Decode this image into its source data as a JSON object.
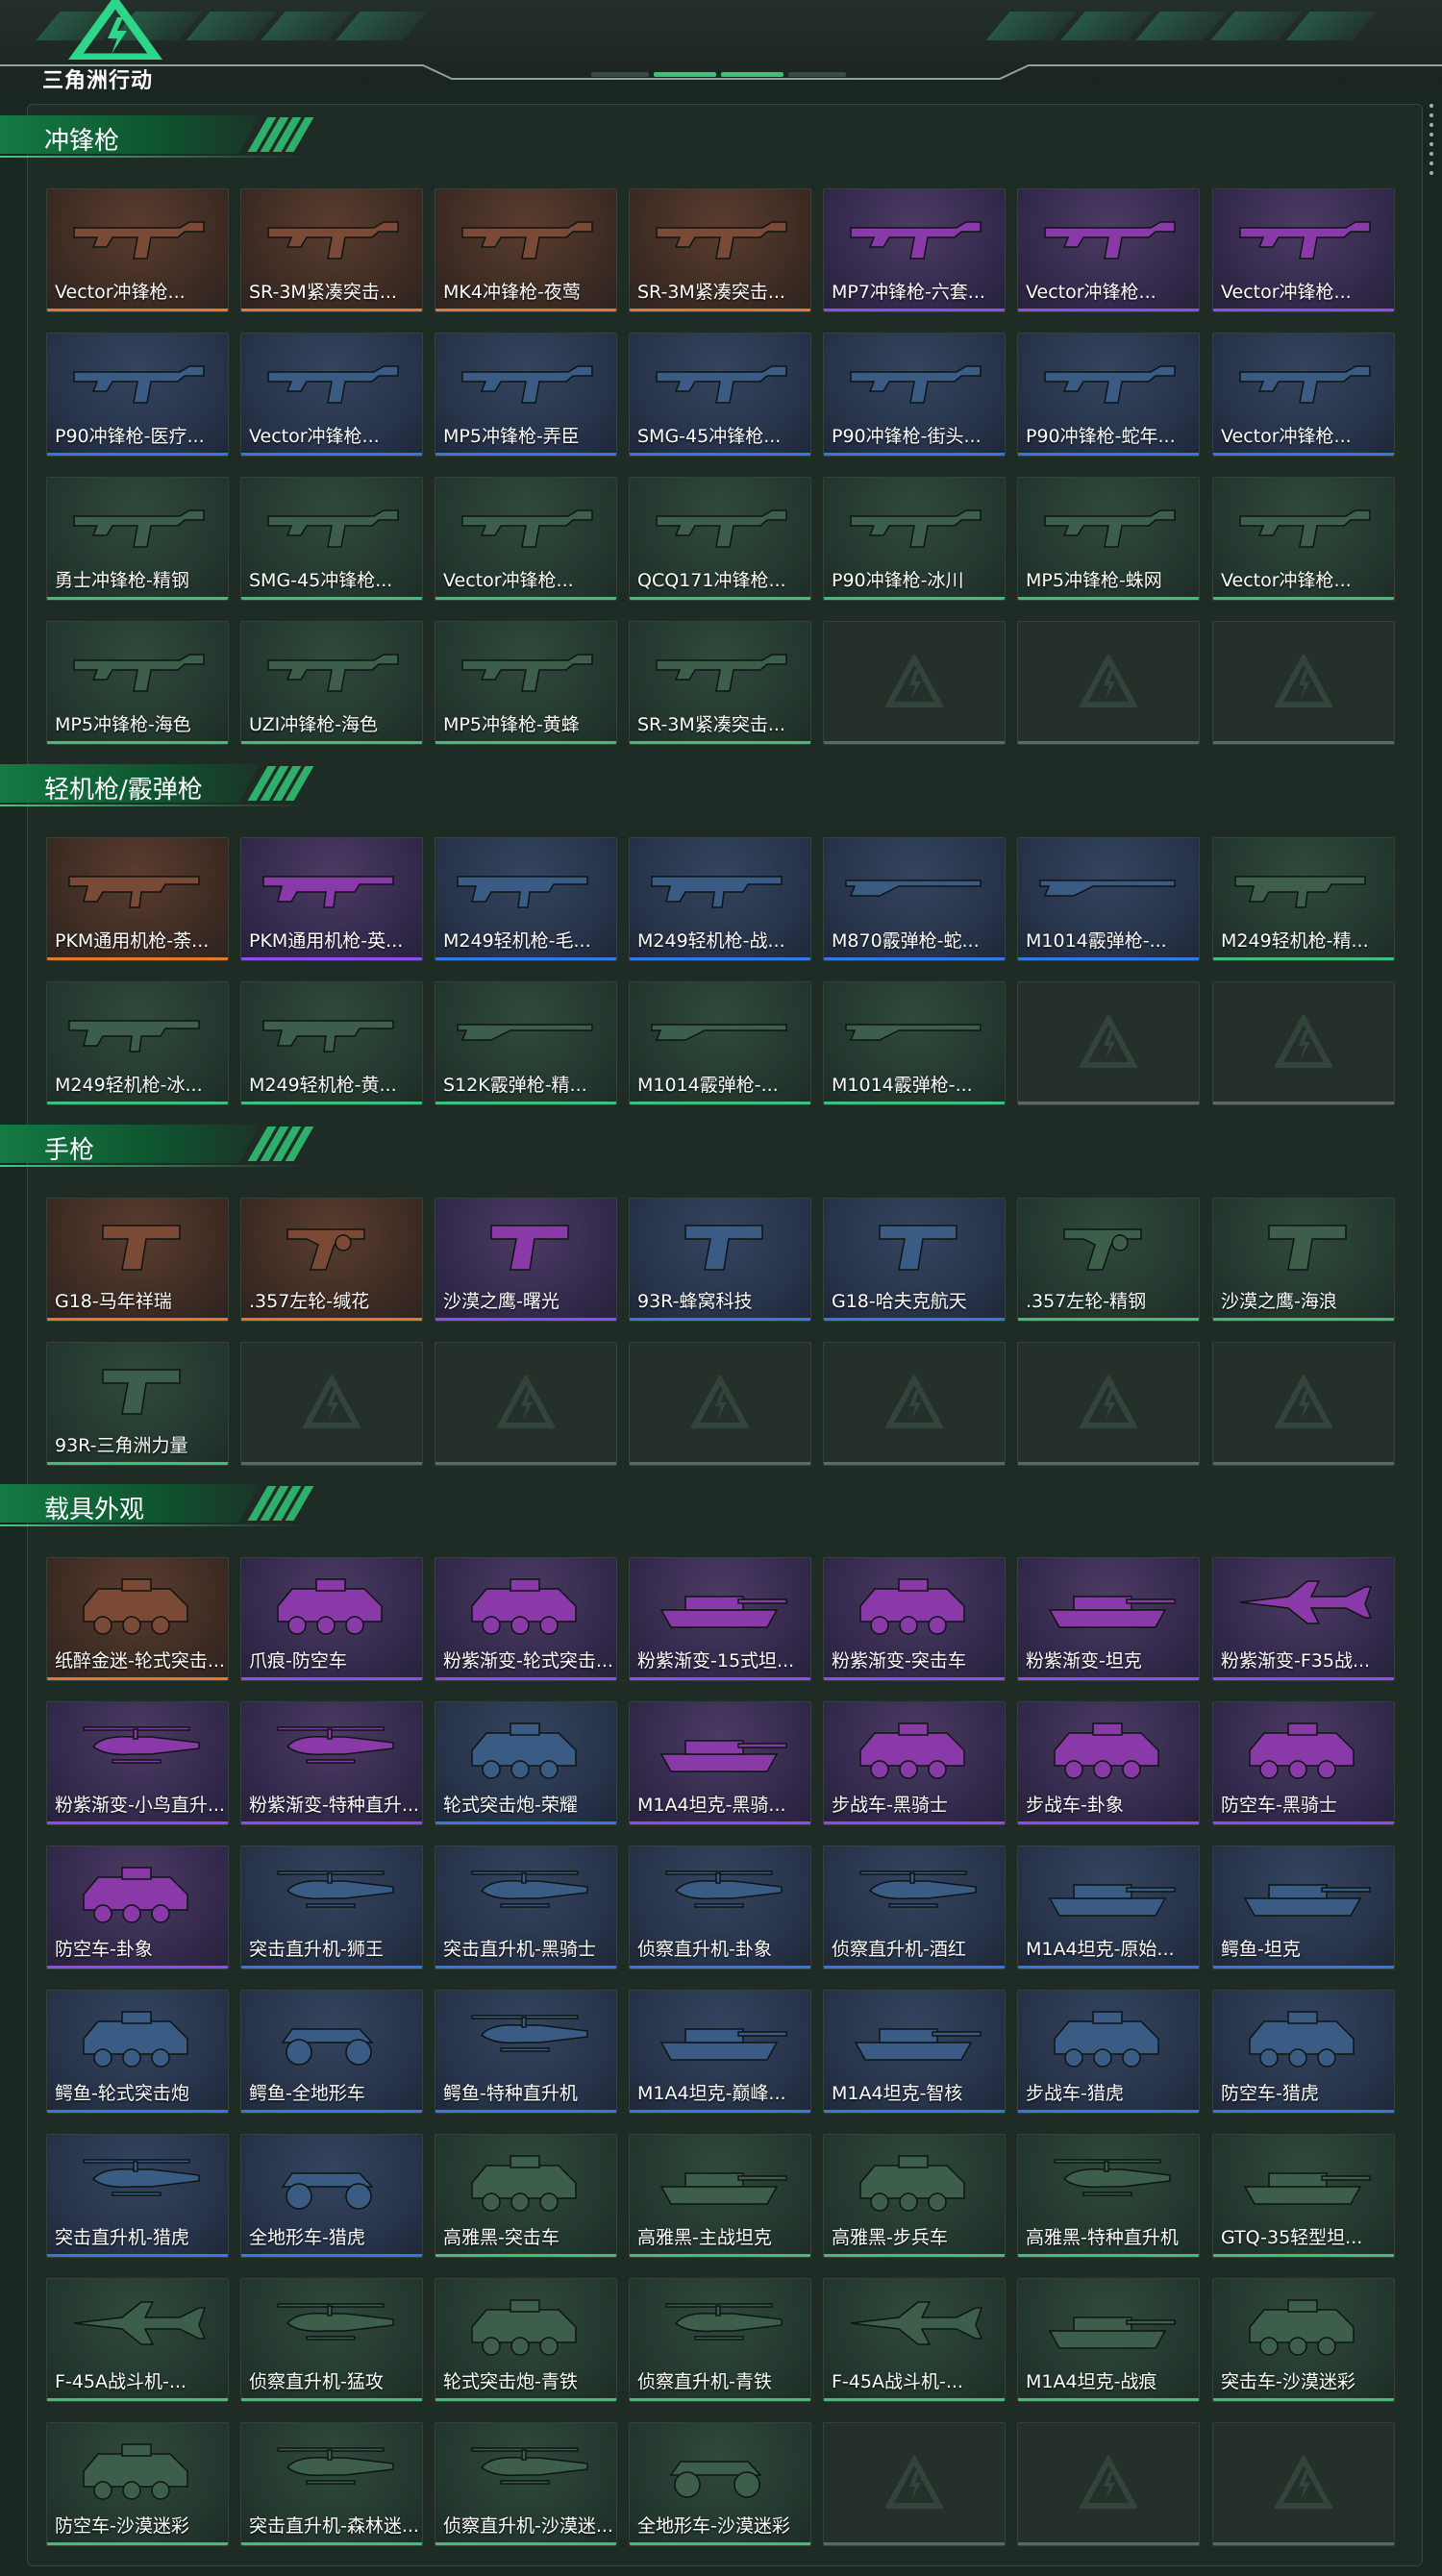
{
  "app": {
    "logo_text": "三角洲行动"
  },
  "colors": {
    "orange": "#e17a2a",
    "purple": "#8b4cf0",
    "blue": "#3778e0",
    "green": "#3fbf7a",
    "accent": "#2fb06a"
  },
  "sections": [
    {
      "title": "冲锋枪",
      "items": [
        {
          "label": "Vector冲锋枪...",
          "rarity": "orange",
          "icon": "smg-icon"
        },
        {
          "label": "SR-3M紧凑突击...",
          "rarity": "orange",
          "icon": "smg-icon"
        },
        {
          "label": "MK4冲锋枪-夜莺",
          "rarity": "orange",
          "icon": "smg-icon"
        },
        {
          "label": "SR-3M紧凑突击...",
          "rarity": "orange",
          "icon": "smg-icon"
        },
        {
          "label": "MP7冲锋枪-六套...",
          "rarity": "purple",
          "icon": "smg-icon"
        },
        {
          "label": "Vector冲锋枪...",
          "rarity": "purple",
          "icon": "smg-icon"
        },
        {
          "label": "Vector冲锋枪...",
          "rarity": "purple",
          "icon": "smg-icon"
        },
        {
          "label": "P90冲锋枪-医疗...",
          "rarity": "blue",
          "icon": "smg-icon"
        },
        {
          "label": "Vector冲锋枪...",
          "rarity": "blue",
          "icon": "smg-icon"
        },
        {
          "label": "MP5冲锋枪-弄臣",
          "rarity": "blue",
          "icon": "smg-icon"
        },
        {
          "label": "SMG-45冲锋枪...",
          "rarity": "blue",
          "icon": "smg-icon"
        },
        {
          "label": "P90冲锋枪-街头...",
          "rarity": "blue",
          "icon": "smg-icon"
        },
        {
          "label": "P90冲锋枪-蛇年...",
          "rarity": "blue",
          "icon": "smg-icon"
        },
        {
          "label": "Vector冲锋枪...",
          "rarity": "blue",
          "icon": "smg-icon"
        },
        {
          "label": "勇士冲锋枪-精钢",
          "rarity": "green",
          "icon": "smg-icon"
        },
        {
          "label": "SMG-45冲锋枪...",
          "rarity": "green",
          "icon": "smg-icon"
        },
        {
          "label": "Vector冲锋枪...",
          "rarity": "green",
          "icon": "smg-icon"
        },
        {
          "label": "QCQ171冲锋枪...",
          "rarity": "green",
          "icon": "smg-icon"
        },
        {
          "label": "P90冲锋枪-冰川",
          "rarity": "green",
          "icon": "smg-icon"
        },
        {
          "label": "MP5冲锋枪-蛛网",
          "rarity": "green",
          "icon": "smg-icon"
        },
        {
          "label": "Vector冲锋枪...",
          "rarity": "green",
          "icon": "smg-icon"
        },
        {
          "label": "MP5冲锋枪-海色",
          "rarity": "green",
          "icon": "smg-icon"
        },
        {
          "label": "UZI冲锋枪-海色",
          "rarity": "green",
          "icon": "smg-icon"
        },
        {
          "label": "MP5冲锋枪-黄蜂",
          "rarity": "green",
          "icon": "smg-icon"
        },
        {
          "label": "SR-3M紧凑突击...",
          "rarity": "green",
          "icon": "smg-icon"
        }
      ]
    },
    {
      "title": "轻机枪/霰弹枪",
      "items": [
        {
          "label": "PKM通用机枪-荼...",
          "rarity": "orange",
          "icon": "lmg-icon"
        },
        {
          "label": "PKM通用机枪-英...",
          "rarity": "purple",
          "icon": "lmg-icon"
        },
        {
          "label": "M249轻机枪-毛...",
          "rarity": "blue",
          "icon": "lmg-icon"
        },
        {
          "label": "M249轻机枪-战...",
          "rarity": "blue",
          "icon": "lmg-icon"
        },
        {
          "label": "M870霰弹枪-蛇...",
          "rarity": "blue",
          "icon": "shotgun-icon"
        },
        {
          "label": "M1014霰弹枪-...",
          "rarity": "blue",
          "icon": "shotgun-icon"
        },
        {
          "label": "M249轻机枪-精...",
          "rarity": "green",
          "icon": "lmg-icon"
        },
        {
          "label": "M249轻机枪-冰...",
          "rarity": "green",
          "icon": "lmg-icon"
        },
        {
          "label": "M249轻机枪-黄...",
          "rarity": "green",
          "icon": "lmg-icon"
        },
        {
          "label": "S12K霰弹枪-精...",
          "rarity": "green",
          "icon": "shotgun-icon"
        },
        {
          "label": "M1014霰弹枪-...",
          "rarity": "green",
          "icon": "shotgun-icon"
        },
        {
          "label": "M1014霰弹枪-...",
          "rarity": "green",
          "icon": "shotgun-icon"
        }
      ]
    },
    {
      "title": "手枪",
      "items": [
        {
          "label": "G18-马年祥瑞",
          "rarity": "orange",
          "icon": "pistol-icon"
        },
        {
          "label": ".357左轮-缄花",
          "rarity": "orange",
          "icon": "revolver-icon"
        },
        {
          "label": "沙漠之鹰-曙光",
          "rarity": "purple",
          "icon": "pistol-icon"
        },
        {
          "label": "93R-蜂窝科技",
          "rarity": "blue",
          "icon": "pistol-icon"
        },
        {
          "label": "G18-哈夫克航天",
          "rarity": "blue",
          "icon": "pistol-icon"
        },
        {
          "label": ".357左轮-精钢",
          "rarity": "green",
          "icon": "revolver-icon"
        },
        {
          "label": "沙漠之鹰-海浪",
          "rarity": "green",
          "icon": "pistol-icon"
        },
        {
          "label": "93R-三角洲力量",
          "rarity": "green",
          "icon": "pistol-icon"
        }
      ]
    },
    {
      "title": "载具外观",
      "items": [
        {
          "label": "纸醉金迷-轮式突击...",
          "rarity": "orange",
          "icon": "vehicle-icon"
        },
        {
          "label": "爪痕-防空车",
          "rarity": "purple",
          "icon": "vehicle-icon"
        },
        {
          "label": "粉紫渐变-轮式突击...",
          "rarity": "purple",
          "icon": "vehicle-icon"
        },
        {
          "label": "粉紫渐变-15式坦...",
          "rarity": "purple",
          "icon": "tank-icon"
        },
        {
          "label": "粉紫渐变-突击车",
          "rarity": "purple",
          "icon": "vehicle-icon"
        },
        {
          "label": "粉紫渐变-坦克",
          "rarity": "purple",
          "icon": "tank-icon"
        },
        {
          "label": "粉紫渐变-F35战...",
          "rarity": "purple",
          "icon": "jet-icon"
        },
        {
          "label": "粉紫渐变-小鸟直升...",
          "rarity": "purple",
          "icon": "helicopter-icon"
        },
        {
          "label": "粉紫渐变-特种直升...",
          "rarity": "purple",
          "icon": "helicopter-icon"
        },
        {
          "label": "轮式突击炮-荣耀",
          "rarity": "blue",
          "icon": "vehicle-icon"
        },
        {
          "label": "M1A4坦克-黑骑...",
          "rarity": "purple",
          "icon": "tank-icon"
        },
        {
          "label": "步战车-黑骑士",
          "rarity": "purple",
          "icon": "vehicle-icon"
        },
        {
          "label": "步战车-卦象",
          "rarity": "purple",
          "icon": "vehicle-icon"
        },
        {
          "label": "防空车-黑骑士",
          "rarity": "purple",
          "icon": "vehicle-icon"
        },
        {
          "label": "防空车-卦象",
          "rarity": "purple",
          "icon": "vehicle-icon"
        },
        {
          "label": "突击直升机-狮王",
          "rarity": "blue",
          "icon": "helicopter-icon"
        },
        {
          "label": "突击直升机-黑骑士",
          "rarity": "blue",
          "icon": "helicopter-icon"
        },
        {
          "label": "侦察直升机-卦象",
          "rarity": "blue",
          "icon": "helicopter-icon"
        },
        {
          "label": "侦察直升机-酒红",
          "rarity": "blue",
          "icon": "helicopter-icon"
        },
        {
          "label": "M1A4坦克-原始...",
          "rarity": "blue",
          "icon": "tank-icon"
        },
        {
          "label": "鳄鱼-坦克",
          "rarity": "blue",
          "icon": "tank-icon"
        },
        {
          "label": "鳄鱼-轮式突击炮",
          "rarity": "blue",
          "icon": "vehicle-icon"
        },
        {
          "label": "鳄鱼-全地形车",
          "rarity": "blue",
          "icon": "atv-icon"
        },
        {
          "label": "鳄鱼-特种直升机",
          "rarity": "blue",
          "icon": "helicopter-icon"
        },
        {
          "label": "M1A4坦克-巅峰...",
          "rarity": "blue",
          "icon": "tank-icon"
        },
        {
          "label": "M1A4坦克-智核",
          "rarity": "blue",
          "icon": "tank-icon"
        },
        {
          "label": "步战车-猎虎",
          "rarity": "blue",
          "icon": "vehicle-icon"
        },
        {
          "label": "防空车-猎虎",
          "rarity": "blue",
          "icon": "vehicle-icon"
        },
        {
          "label": "突击直升机-猎虎",
          "rarity": "blue",
          "icon": "helicopter-icon"
        },
        {
          "label": "全地形车-猎虎",
          "rarity": "blue",
          "icon": "atv-icon"
        },
        {
          "label": "高雅黑-突击车",
          "rarity": "green",
          "icon": "vehicle-icon"
        },
        {
          "label": "高雅黑-主战坦克",
          "rarity": "green",
          "icon": "tank-icon"
        },
        {
          "label": "高雅黑-步兵车",
          "rarity": "green",
          "icon": "vehicle-icon"
        },
        {
          "label": "高雅黑-特种直升机",
          "rarity": "green",
          "icon": "helicopter-icon"
        },
        {
          "label": "GTQ-35轻型坦...",
          "rarity": "green",
          "icon": "tank-icon"
        },
        {
          "label": "F-45A战斗机-...",
          "rarity": "green",
          "icon": "jet-icon"
        },
        {
          "label": "侦察直升机-猛攻",
          "rarity": "green",
          "icon": "helicopter-icon"
        },
        {
          "label": "轮式突击炮-青铁",
          "rarity": "green",
          "icon": "vehicle-icon"
        },
        {
          "label": "侦察直升机-青铁",
          "rarity": "green",
          "icon": "helicopter-icon"
        },
        {
          "label": "F-45A战斗机-...",
          "rarity": "green",
          "icon": "jet-icon"
        },
        {
          "label": "M1A4坦克-战痕",
          "rarity": "green",
          "icon": "tank-icon"
        },
        {
          "label": "突击车-沙漠迷彩",
          "rarity": "green",
          "icon": "vehicle-icon"
        },
        {
          "label": "防空车-沙漠迷彩",
          "rarity": "green",
          "icon": "vehicle-icon"
        },
        {
          "label": "突击直升机-森林迷...",
          "rarity": "green",
          "icon": "helicopter-icon"
        },
        {
          "label": "侦察直升机-沙漠迷...",
          "rarity": "green",
          "icon": "helicopter-icon"
        },
        {
          "label": "全地形车-沙漠迷彩",
          "rarity": "green",
          "icon": "atv-icon"
        }
      ]
    }
  ]
}
